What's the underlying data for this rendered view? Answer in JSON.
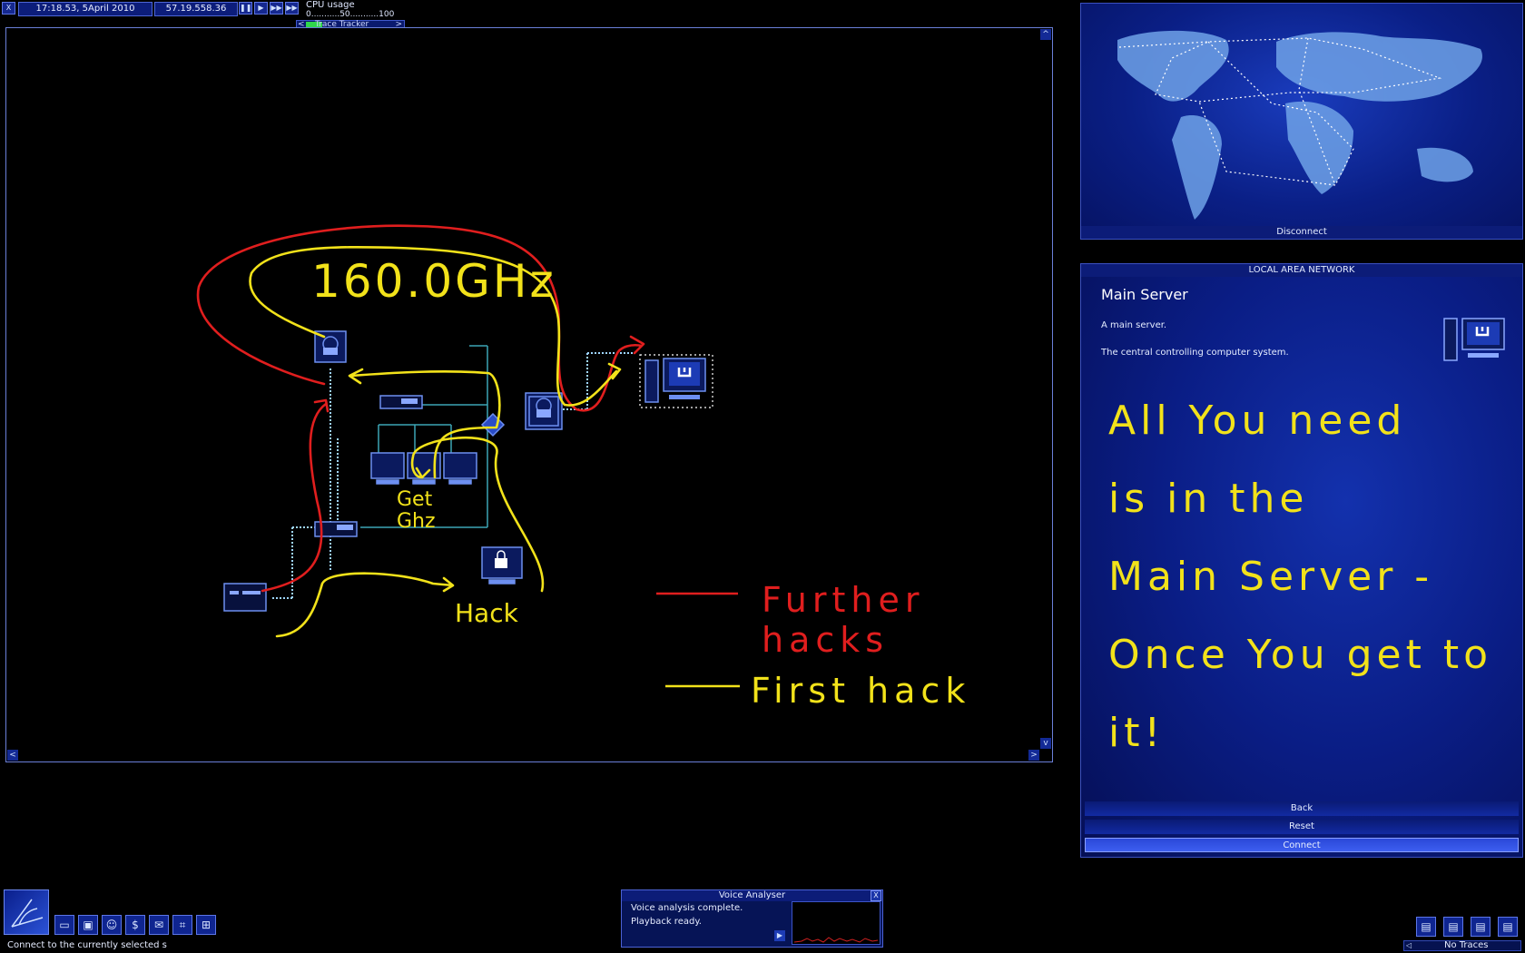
{
  "topbar": {
    "close_glyph": "X",
    "date_time": "17:18.53, 5April 2010",
    "speed_time": "57.19.558.36",
    "controls": [
      "pause",
      "play",
      "fast",
      "fastest"
    ],
    "cpu_label": "CPU usage",
    "cpu_scale": "0...........50...........100",
    "trace_left": "<",
    "trace_label": "Trace  Tracker",
    "trace_right": ">"
  },
  "mapview": {
    "annotations": {
      "ghz_note": "160.0GHz",
      "get_note_line1": "Get",
      "get_note_line2": "Ghz",
      "hack_note": "Hack",
      "legend_red": "Further hacks",
      "legend_yellow": "First hack"
    },
    "corner_up": "^",
    "corner_down": "v",
    "corner_left": "<",
    "corner_right": ">",
    "colors": {
      "red": "#e01e1e",
      "yellow": "#f2e21a",
      "link": "#9fd6ff"
    }
  },
  "worldmap": {
    "disconnect_label": "Disconnect"
  },
  "lan": {
    "header": "LOCAL AREA NETWORK",
    "title": "Main Server",
    "desc1": "A main server.",
    "desc2": "The central controlling computer system.",
    "note_lines": [
      "All  You  need",
      "is  in  the",
      "Main  Server -",
      "Once  You  get  to",
      "it!"
    ],
    "back_label": "Back",
    "reset_label": "Reset",
    "connect_label": "Connect"
  },
  "bottom": {
    "status_text": "Connect to the currently selected s",
    "icons": [
      "satellite-dish-icon",
      "computer-icon",
      "floppy-disk-icon",
      "person-icon",
      "dollar-icon",
      "mail-icon",
      "network-icon",
      "gateway-icon"
    ],
    "dollar_glyph": "$",
    "voice": {
      "title": "Voice Analyser",
      "line1": "Voice analysis complete.",
      "line2": "Playback ready.",
      "close_glyph": "X"
    },
    "traces_label": "No Traces"
  }
}
